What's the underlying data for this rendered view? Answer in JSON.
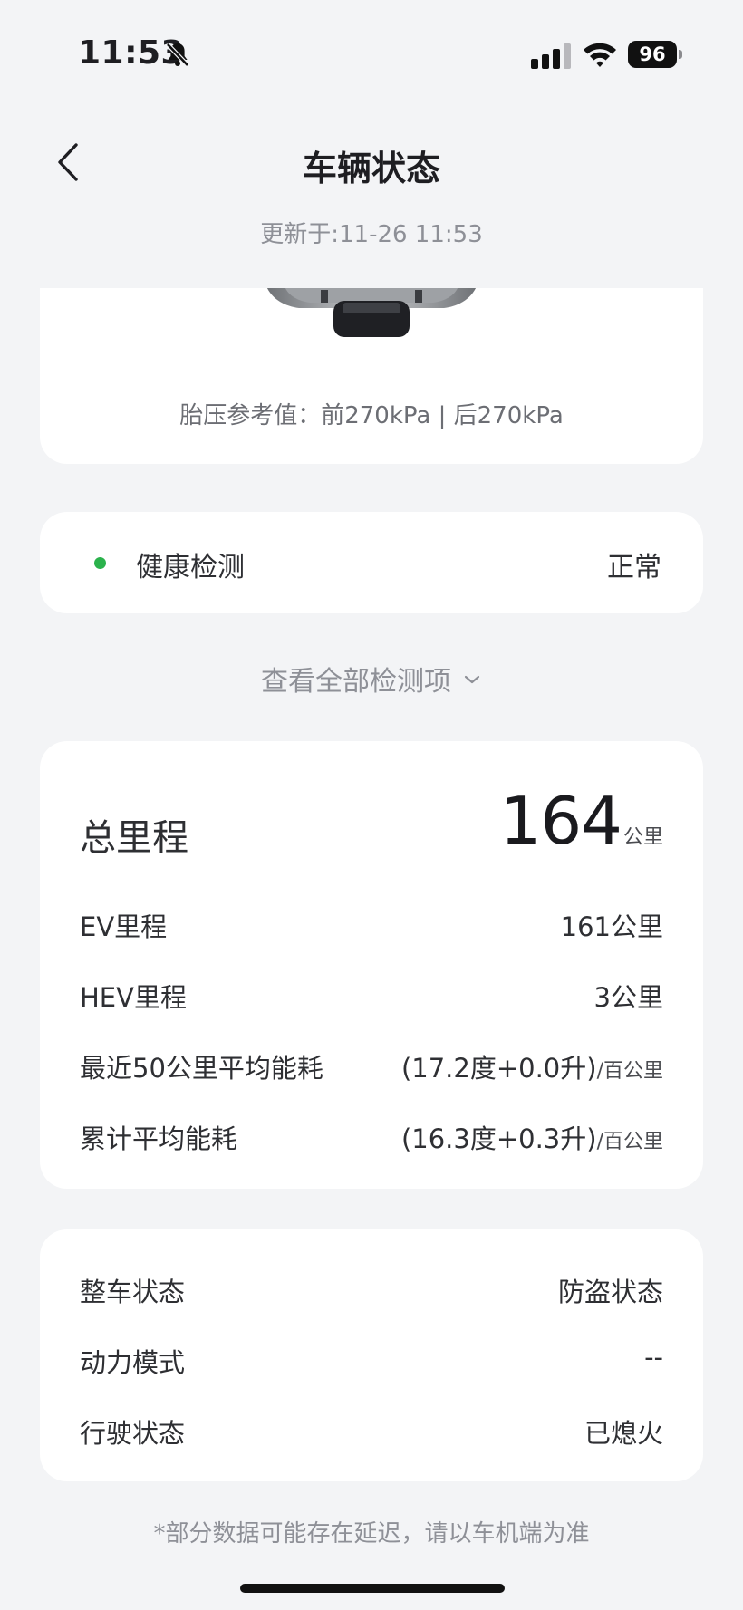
{
  "status_bar": {
    "time": "11:53",
    "battery": "96",
    "icons": [
      "bell-slash-icon",
      "cellular-signal-icon",
      "wifi-icon",
      "battery-icon"
    ]
  },
  "header": {
    "title": "车辆状态",
    "back_icon": "chevron-left-icon",
    "updated": "更新于:11-26 11:53"
  },
  "tire": {
    "pressure_text": "胎压参考值：前270kPa | 后270kPa"
  },
  "health": {
    "label": "健康检测",
    "value": "正常",
    "status_color": "#2bb24c"
  },
  "view_all": {
    "label": "查看全部检测项",
    "icon": "chevron-down-icon"
  },
  "mileage": {
    "total_label": "总里程",
    "total_value": "164",
    "total_unit": "公里",
    "rows": [
      {
        "label": "EV里程",
        "value": "161公里",
        "unit": ""
      },
      {
        "label": "HEV里程",
        "value": "3公里",
        "unit": ""
      },
      {
        "label": "最近50公里平均能耗",
        "value": "(17.2度+0.0升)",
        "unit": "/百公里"
      },
      {
        "label": "累计平均能耗",
        "value": "(16.3度+0.3升)",
        "unit": "/百公里"
      }
    ]
  },
  "vehicle_state": {
    "rows": [
      {
        "label": "整车状态",
        "value": "防盗状态"
      },
      {
        "label": "动力模式",
        "value": "--"
      },
      {
        "label": "行驶状态",
        "value": "已熄火"
      }
    ]
  },
  "footnote": "*部分数据可能存在延迟，请以车机端为准"
}
